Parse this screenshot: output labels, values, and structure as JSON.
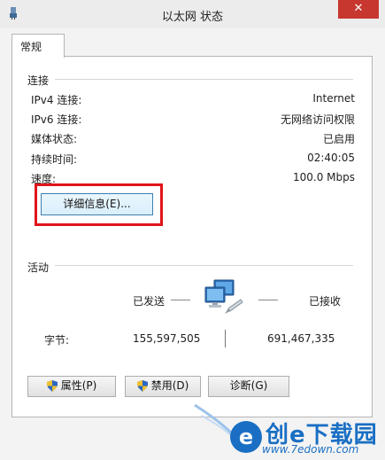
{
  "window": {
    "title": "以太网 状态",
    "close_glyph": "✕"
  },
  "tabs": [
    {
      "label": "常规"
    }
  ],
  "connection": {
    "section_title": "连接",
    "rows": [
      {
        "label": "IPv4 连接:",
        "value": "Internet"
      },
      {
        "label": "IPv6 连接:",
        "value": "无网络访问权限"
      },
      {
        "label": "媒体状态:",
        "value": "已启用"
      },
      {
        "label": "持续时间:",
        "value": "02:40:05"
      },
      {
        "label": "速度:",
        "value": "100.0 Mbps"
      }
    ],
    "details_button": "详细信息(E)..."
  },
  "activity": {
    "section_title": "活动",
    "sent_label": "已发送",
    "received_label": "已接收",
    "bytes_label": "字节:",
    "bytes_sent": "155,597,505",
    "bytes_received": "691,467,335"
  },
  "buttons": {
    "properties": "属性(P)",
    "disable": "禁用(D)",
    "diagnose": "诊断(G)"
  },
  "watermark": {
    "text": "创e下载园",
    "url": "www.7edown.com"
  },
  "colors": {
    "highlight": "#e1141b",
    "close": "#c7372f",
    "accent": "#3c7fb1"
  }
}
